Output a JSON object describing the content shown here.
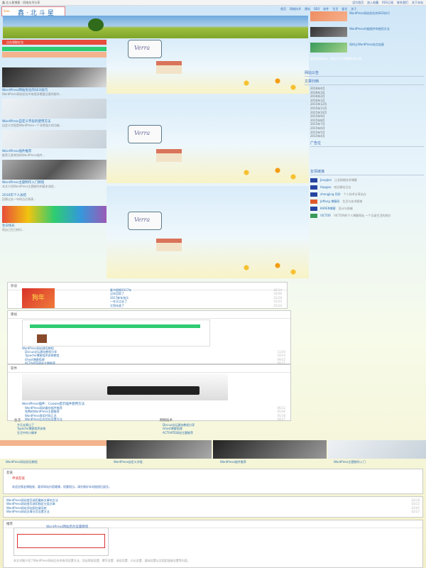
{
  "topbar": {
    "left_text": "鑫·北斗星博客 - 网络技术分享",
    "links": [
      "设为首页",
      "加入收藏",
      "RSS订阅",
      "联系我们",
      "关于本站"
    ]
  },
  "header": {
    "logo_tag": "Sino",
    "site_name": "鑫·北斗星",
    "nav": [
      "首页",
      "网络技术",
      "建站",
      "SEO",
      "软件",
      "生活",
      "留言",
      "关于"
    ]
  },
  "scene": {
    "sign_text": "Verra"
  },
  "sidebar": {
    "recent_posts": [
      "WordPress网站优化的SEO技巧",
      "WordPress内链插件的使用方法",
      "如何让WordPress站点加速"
    ],
    "notice_title": "网站公告",
    "notice_text": "欢迎访问本站，本站专注于网络技术分享",
    "archive_title": "文章归档",
    "archive": [
      "2016年4月",
      "2016年3月",
      "2016年2月",
      "2016年1月",
      "2015年12月",
      "2015年11月",
      "2015年10月",
      "2015年9月",
      "2015年8月",
      "2015年7月",
      "2015年6月",
      "2015年5月",
      "2015年4月"
    ],
    "ad_title": "广告位",
    "links_title": "友情链接",
    "links": [
      {
        "name": "Jiangbei",
        "desc": "江北网络技术博客"
      },
      {
        "name": "Hapgoo",
        "desc": "哈谷建站日志"
      },
      {
        "name": "zhengjing 同学",
        "desc": "个人技术分享站点"
      },
      {
        "name": "Jeffang 博客网",
        "desc": "生活与技术随笔"
      },
      {
        "name": "KAREN博客",
        "desc": "设计与前端"
      },
      {
        "name": "VICTOR",
        "desc": "VICTOR的个人博客网站 一个记录生活的地方"
      }
    ]
  },
  "left": {
    "ad_label": "点击领取红包",
    "posts": [
      {
        "title": "WordPress网站优化的SEO技巧",
        "excerpt": "WordPress网站优化中有很多需要注意的细节..."
      },
      {
        "title": "WordPress自定义字段的使用方法",
        "excerpt": "自定义字段是WordPress一个非常强大的功能..."
      },
      {
        "title": "WordPress插件推荐",
        "excerpt": "推荐几款常用的WordPress插件..."
      },
      {
        "title": "WordPress主题制作入门教程",
        "excerpt": "本文介绍WordPress主题制作的基本流程..."
      },
      {
        "title": "2016年个人总结",
        "excerpt": "回顾过去一年的点点滴滴..."
      },
      {
        "title": "生日快乐",
        "excerpt": "祝自己生日快乐..."
      }
    ]
  },
  "box1": {
    "header": "杂谈",
    "sale_text": "狗年",
    "items": [
      {
        "title": "春节假期2017年",
        "date": "02/14"
      },
      {
        "title": "过年回家了",
        "date": "02/06"
      },
      {
        "title": "2017新年快乐",
        "date": "01/28"
      },
      {
        "title": "一年又过去了",
        "date": "01/20"
      },
      {
        "title": "又到年底了",
        "date": "01/10"
      }
    ]
  },
  "box2": {
    "header": "建站",
    "caption": "WordPress网站建设教程",
    "items": [
      {
        "title": "Discuz论坛建站教程分享",
        "date": "11/20"
      },
      {
        "title": "Typecho博客程序安装教程",
        "date": "10/14"
      },
      {
        "title": "Ghost博客搭建",
        "date": "09/22"
      },
      {
        "title": "ACTIVATE网站主题推荐",
        "date": "08/15"
      }
    ]
  },
  "box3": {
    "header": "软件",
    "caption": "WordPress插件：Cookie提示插件使用方法",
    "items": [
      {
        "title": "WordPress网站备份插件推荐",
        "date": "06/12"
      },
      {
        "title": "免费的WordPress主题推荐",
        "date": "05/30"
      },
      {
        "title": "WordPress常用代码汇总",
        "date": "05/18"
      },
      {
        "title": "WordPress后台优化设置方法",
        "date": "04/27"
      }
    ]
  },
  "twin": [
    {
      "header": "生活",
      "items": [
        "今天去爬山了",
        "Typecho博客程序安装",
        "生活中的小确幸"
      ]
    },
    {
      "header": "网络技术",
      "items": [
        "Discuz论坛建站教程分享",
        "Ghost博客搭建",
        "ACTIVATE网站主题推荐"
      ]
    }
  ],
  "strip": [
    {
      "caption": "WordPress网站优化教程"
    },
    {
      "caption": "WordPress自定义字段"
    },
    {
      "caption": "WordPress插件推荐"
    },
    {
      "caption": "WordPress主题制作入门"
    }
  ],
  "links_box": {
    "header": "友链",
    "badge": "申请友链",
    "desc": "欢迎交换友情链接，要求网站内容健康，权重相当，请先做好本站链接后留言。"
  },
  "news_box": {
    "items": [
      {
        "title": "WordPress网站首页调用最新文章的方法",
        "date": "03/18"
      },
      {
        "title": "WordPress网站首页调用指定分类文章",
        "date": "03/12"
      },
      {
        "title": "WordPress网站添加面包屑导航",
        "date": "03/05"
      },
      {
        "title": "WordPress网站文章分页设置方法",
        "date": "02/27"
      }
    ]
  },
  "last_box": {
    "header": "推荐",
    "title": "WordPress网站后台设置教程",
    "desc": "本文详细介绍了WordPress网站后台的各项设置方法，包括常规设置、撰写设置、阅读设置、讨论设置、媒体设置以及固定链接设置等内容。"
  }
}
